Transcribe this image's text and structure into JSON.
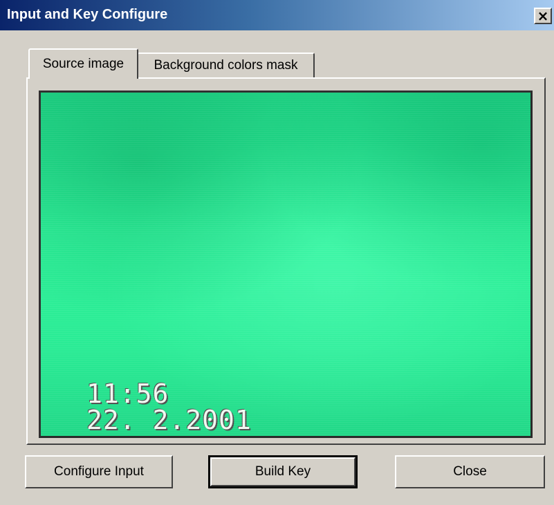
{
  "window": {
    "title": "Input and Key Configure",
    "close_glyph": "×",
    "close_icon": "close-icon",
    "colors": {
      "titlebar_start": "#0a246a",
      "titlebar_end": "#a6caf0",
      "face": "#d4d0c8",
      "video_green": "#2ff29a"
    }
  },
  "tabs": [
    {
      "label": "Source image",
      "selected": true
    },
    {
      "label": "Background colors mask",
      "selected": false
    }
  ],
  "video": {
    "osd_time": "11:56",
    "osd_date": "22. 2.2001"
  },
  "buttons": {
    "configure_input": "Configure Input",
    "build_key": "Build Key",
    "close": "Close"
  }
}
